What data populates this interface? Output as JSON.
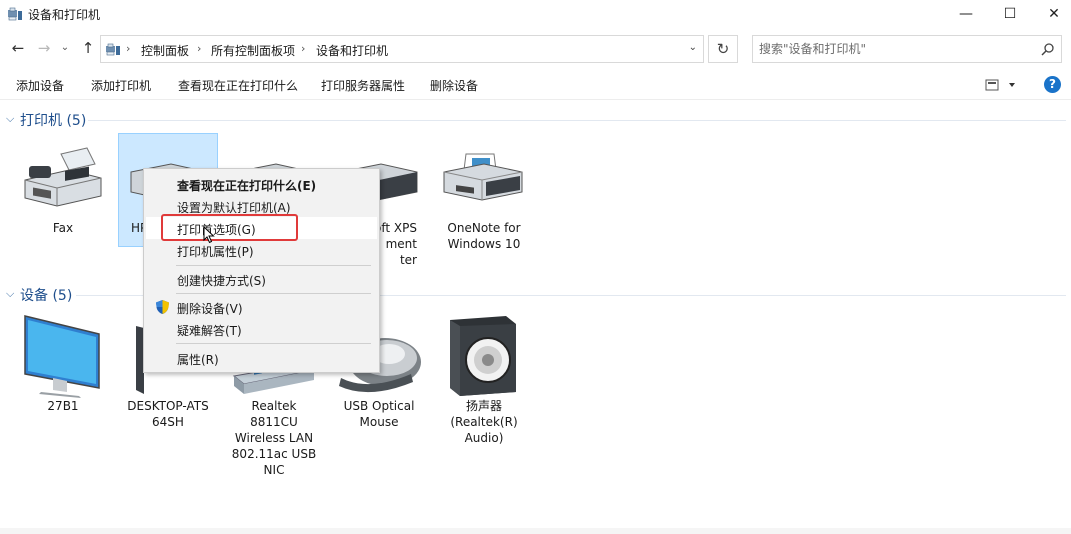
{
  "window": {
    "title": "设备和打印机"
  },
  "address": {
    "crumbs": [
      "控制面板",
      "所有控制面板项",
      "设备和打印机"
    ],
    "search_placeholder": "搜索\"设备和打印机\""
  },
  "toolbar": {
    "commands": [
      "添加设备",
      "添加打印机",
      "查看现在正在打印什么",
      "打印服务器属性",
      "删除设备"
    ]
  },
  "groups": {
    "printers": {
      "title": "打印机 (5)",
      "items": [
        {
          "label": "Fax",
          "icon": "fax-icon"
        },
        {
          "label": "HP",
          "icon": "printer-icon",
          "selected": true
        },
        {
          "label": "",
          "icon": "printer-icon"
        },
        {
          "label": "oft XPS\nment\nter",
          "icon": "printer-icon"
        },
        {
          "label": "OneNote for Windows 10",
          "icon": "printer-icon"
        }
      ]
    },
    "devices": {
      "title": "设备 (5)",
      "items": [
        {
          "label": "27B1",
          "icon": "monitor-icon"
        },
        {
          "label": "DESKTOP-ATS64SH",
          "icon": "computer-icon"
        },
        {
          "label": "Realtek 8811CU Wireless LAN 802.11ac USB NIC",
          "icon": "network-adapter-icon"
        },
        {
          "label": "USB Optical Mouse",
          "icon": "mouse-icon"
        },
        {
          "label": "扬声器 (Realtek(R) Audio)",
          "icon": "speaker-icon"
        }
      ]
    }
  },
  "context_menu": {
    "items": [
      {
        "label": "查看现在正在打印什么(E)",
        "bold": true
      },
      {
        "label": "设置为默认打印机(A)"
      },
      {
        "label": "打印首选项(G)",
        "highlighted": true
      },
      {
        "label": "打印机属性(P)"
      },
      {
        "label": "创建快捷方式(S)"
      },
      {
        "label": "删除设备(V)",
        "icon": "shield-icon"
      },
      {
        "label": "疑难解答(T)"
      },
      {
        "label": "属性(R)"
      }
    ]
  },
  "colors": {
    "accent": "#1a73c9",
    "highlight_border": "#e03a3a",
    "selection": "#cce8ff"
  }
}
